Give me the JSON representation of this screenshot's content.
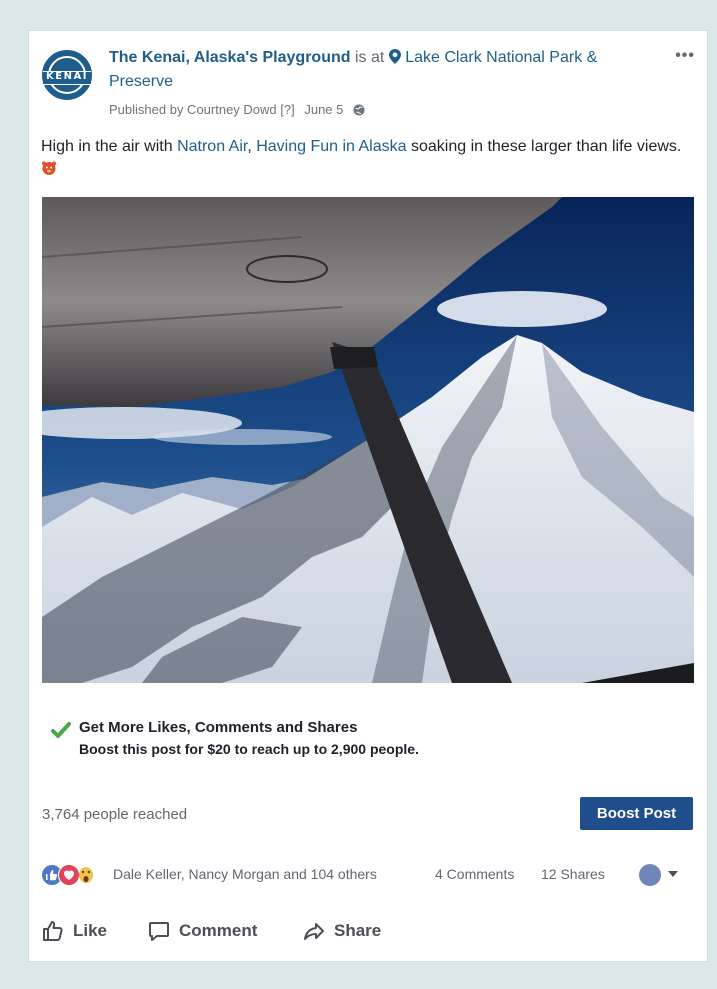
{
  "post": {
    "page_name": "The Kenai, Alaska's Playground",
    "is_at": "is at",
    "location": "Lake Clark National Park & Preserve",
    "published_by": "Published by Courtney Dowd [?]",
    "date": "June 5",
    "logo_text": "KENAI",
    "text": {
      "part1": "High in the air with ",
      "link1": "Natron Air",
      "part2": ", ",
      "link2": "Having Fun in Alaska",
      "part3": " soaking in these larger than life views."
    },
    "more_label": "•••"
  },
  "boost": {
    "title": "Get More Likes, Comments and Shares",
    "subtitle": "Boost this post for $20 to reach up to 2,900 people.",
    "reached": "3,764 people reached",
    "button": "Boost Post"
  },
  "engagement": {
    "reactors": "Dale Keller, Nancy Morgan and 104 others",
    "comments": "4 Comments",
    "shares": "12 Shares"
  },
  "actions": {
    "like": "Like",
    "comment": "Comment",
    "share": "Share"
  },
  "colors": {
    "brand_blue": "#1f5d8c",
    "button_blue": "#1f4e8a",
    "check_green": "#4aa84a"
  }
}
